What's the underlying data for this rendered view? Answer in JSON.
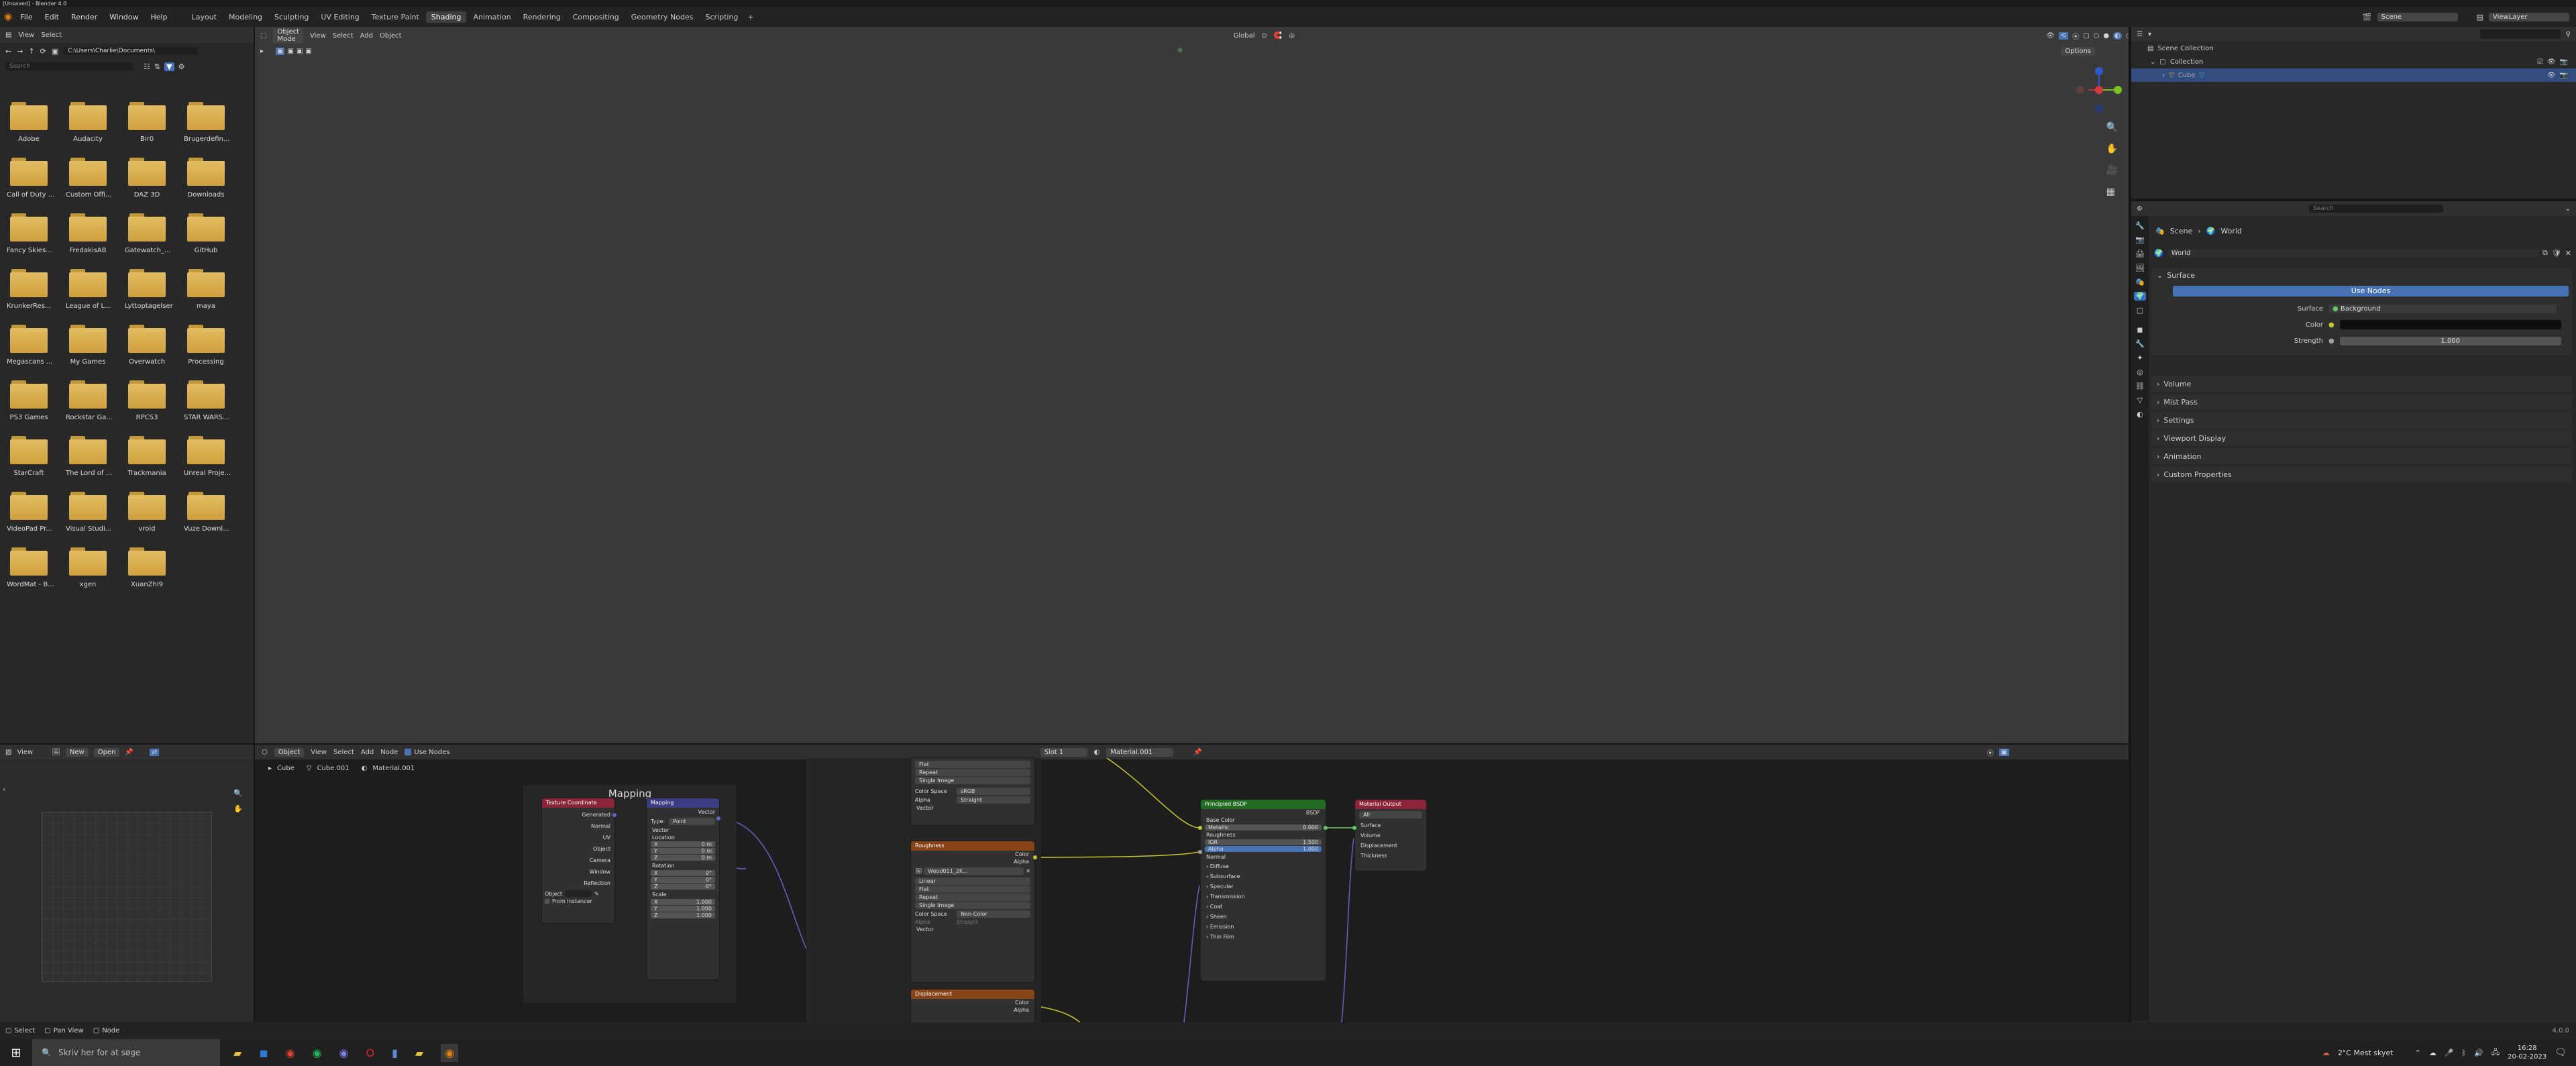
{
  "window": {
    "title": "[Unsaved] - Blender 4.0"
  },
  "menu": {
    "items": [
      "File",
      "Edit",
      "Render",
      "Window",
      "Help"
    ]
  },
  "workspaces": [
    "Layout",
    "Modeling",
    "Sculpting",
    "UV Editing",
    "Texture Paint",
    "Shading",
    "Animation",
    "Rendering",
    "Compositing",
    "Geometry Nodes",
    "Scripting"
  ],
  "active_workspace": "Shading",
  "scene": {
    "name": "Scene",
    "view_layer": "ViewLayer"
  },
  "filebrowser": {
    "menu": [
      "View",
      "Select"
    ],
    "path": "C:\\Users\\Charlie\\Documents\\",
    "search_placeholder": "Search",
    "folders": [
      "Adobe",
      "Audacity",
      "Bir0",
      "Brugerdefin...",
      "Call of Duty ...",
      "Custom Offi...",
      "DAZ 3D",
      "Downloads",
      "Fancy Skies...",
      "FredakisAB",
      "Gatewatch_...",
      "GitHub",
      "KrunkerRes...",
      "League of L...",
      "Lyttoptagelser",
      "maya",
      "Megascans ...",
      "My Games",
      "Overwatch",
      "Processing",
      "PS3 Games",
      "Rockstar Ga...",
      "RPCS3",
      "STAR WARS...",
      "StarCraft",
      "The Lord of ...",
      "Trackmania",
      "Unreal Proje...",
      "VideoPad Pr...",
      "Visual Studi...",
      "vroid",
      "Vuze Downl...",
      "WordMat - B...",
      "xgen",
      "XuanZhi9"
    ]
  },
  "viewport": {
    "mode": "Object Mode",
    "menu": [
      "View",
      "Select",
      "Add",
      "Object"
    ],
    "transform": "Global",
    "options": "Options"
  },
  "image_editor": {
    "view": "View",
    "new": "New",
    "open": "Open"
  },
  "node_editor": {
    "object": "Object",
    "menu": [
      "View",
      "Select",
      "Add",
      "Node"
    ],
    "use_nodes": "Use Nodes",
    "slot": "Slot 1",
    "material": "Material.001",
    "breadcrumb": [
      "Cube",
      "Cube.001",
      "Material.001"
    ],
    "frame_label": "Mapping",
    "tex_coord": {
      "title": "Texture Coordinate",
      "outputs": [
        "Generated",
        "Normal",
        "UV",
        "Object",
        "Camera",
        "Window",
        "Reflection"
      ],
      "object_label": "Object",
      "from_instancer": "From Instancer"
    },
    "mapping": {
      "title": "Mapping",
      "out": "Vector",
      "type_label": "Type:",
      "type_value": "Point",
      "vector": "Vector",
      "location": "Location",
      "loc": [
        "0 m",
        "0 m",
        "0 m"
      ],
      "rotation": "Rotation",
      "rot": [
        "0°",
        "0°",
        "0°"
      ],
      "scale": "Scale",
      "scl": [
        "1.000",
        "1.000",
        "1.000"
      ],
      "axes": [
        "X",
        "Y",
        "Z"
      ]
    },
    "image_top": {
      "rows": [
        "Flat",
        "Repeat",
        "Single Image"
      ],
      "color_space_label": "Color Space",
      "color_space": "sRGB",
      "alpha_label": "Alpha",
      "alpha": "Straight",
      "vector": "Vector"
    },
    "roughness": {
      "title": "Roughness",
      "out_color": "Color",
      "out_alpha": "Alpha",
      "image": "Wood011_2K...",
      "rows": [
        "Linear",
        "Flat",
        "Repeat",
        "Single Image"
      ],
      "color_space_label": "Color Space",
      "color_space": "Non-Color",
      "alpha_label": "Alpha",
      "alpha": "Straight",
      "vector": "Vector"
    },
    "displacement": {
      "title": "Displacement",
      "out_color": "Color",
      "out_alpha": "Alpha"
    },
    "bsdf": {
      "title": "Principled BSDF",
      "out": "BSDF",
      "base_color": "Base Color",
      "metallic_label": "Metallic",
      "metallic": "0.000",
      "roughness": "Roughness",
      "ior_label": "IOR",
      "ior": "1.500",
      "alpha_label": "Alpha",
      "alpha": "1.000",
      "normal": "Normal",
      "panels": [
        "Diffuse",
        "Subsurface",
        "Specular",
        "Transmission",
        "Coat",
        "Sheen",
        "Emission",
        "Thin Film"
      ]
    },
    "output": {
      "title": "Material Output",
      "target": "All",
      "inputs": [
        "Surface",
        "Volume",
        "Displacement",
        "Thickness"
      ]
    }
  },
  "outliner": {
    "search_placeholder": "",
    "items": [
      {
        "label": "Scene Collection"
      },
      {
        "label": "Collection"
      },
      {
        "label": "Cube"
      }
    ]
  },
  "properties": {
    "search_placeholder": "Search",
    "breadcrumb": [
      "Scene",
      "World"
    ],
    "world_name": "World",
    "surface_header": "Surface",
    "use_nodes": "Use Nodes",
    "surface_label": "Surface",
    "surface_value": "Background",
    "color_label": "Color",
    "strength_label": "Strength",
    "strength_value": "1.000",
    "subpanels": [
      "Volume",
      "Mist Pass",
      "Settings",
      "Viewport Display",
      "Animation",
      "Custom Properties"
    ]
  },
  "statusbar": {
    "items": [
      "Select",
      "Pan View",
      "Node"
    ],
    "version": "4.0.0"
  },
  "taskbar": {
    "search_placeholder": "Skriv her for at søge",
    "weather": "2°C  Mest skyet",
    "time": "16:28",
    "date": "20-02-2023"
  },
  "colors": {
    "accent": "#4772b3",
    "folder": "#dcb24f",
    "uv_link": "#6363c7",
    "color_link": "#c7c729"
  }
}
